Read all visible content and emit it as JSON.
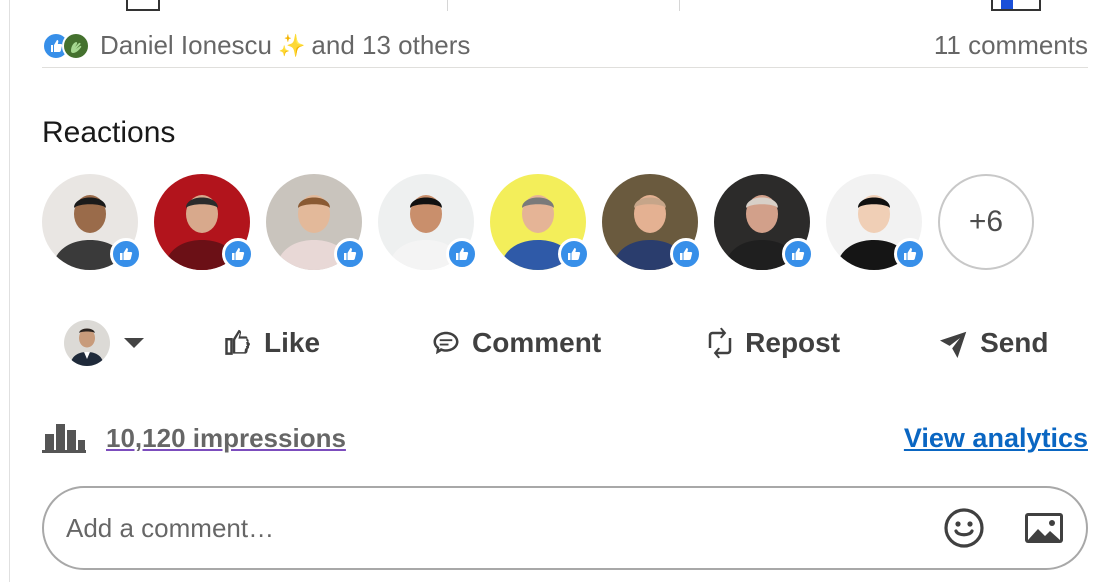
{
  "social": {
    "reactor_name": "Daniel Ionescu",
    "sparkle": "✨",
    "others_text": "and 13 others",
    "comments_count": "11 comments"
  },
  "reactions": {
    "title": "Reactions",
    "more_count": "+6",
    "avatars": [
      {
        "icon": "like-icon",
        "bg": "#e9e6e3"
      },
      {
        "icon": "like-icon",
        "bg": "#b2141c"
      },
      {
        "icon": "like-icon",
        "bg": "#c9c4bd"
      },
      {
        "icon": "like-icon",
        "bg": "#eef0f0"
      },
      {
        "icon": "like-icon",
        "bg": "#f3ee5a"
      },
      {
        "icon": "like-icon",
        "bg": "#6a5a3e"
      },
      {
        "icon": "like-icon",
        "bg": "#2c2b2a"
      },
      {
        "icon": "like-icon",
        "bg": "#f2f2f2"
      }
    ]
  },
  "actions": {
    "like": "Like",
    "comment": "Comment",
    "repost": "Repost",
    "send": "Send"
  },
  "stats": {
    "impressions": "10,120 impressions",
    "analytics": "View analytics"
  },
  "comment_box": {
    "placeholder": "Add a comment…"
  },
  "colors": {
    "like_blue": "#378fe9",
    "link_blue": "#0a66c2"
  }
}
